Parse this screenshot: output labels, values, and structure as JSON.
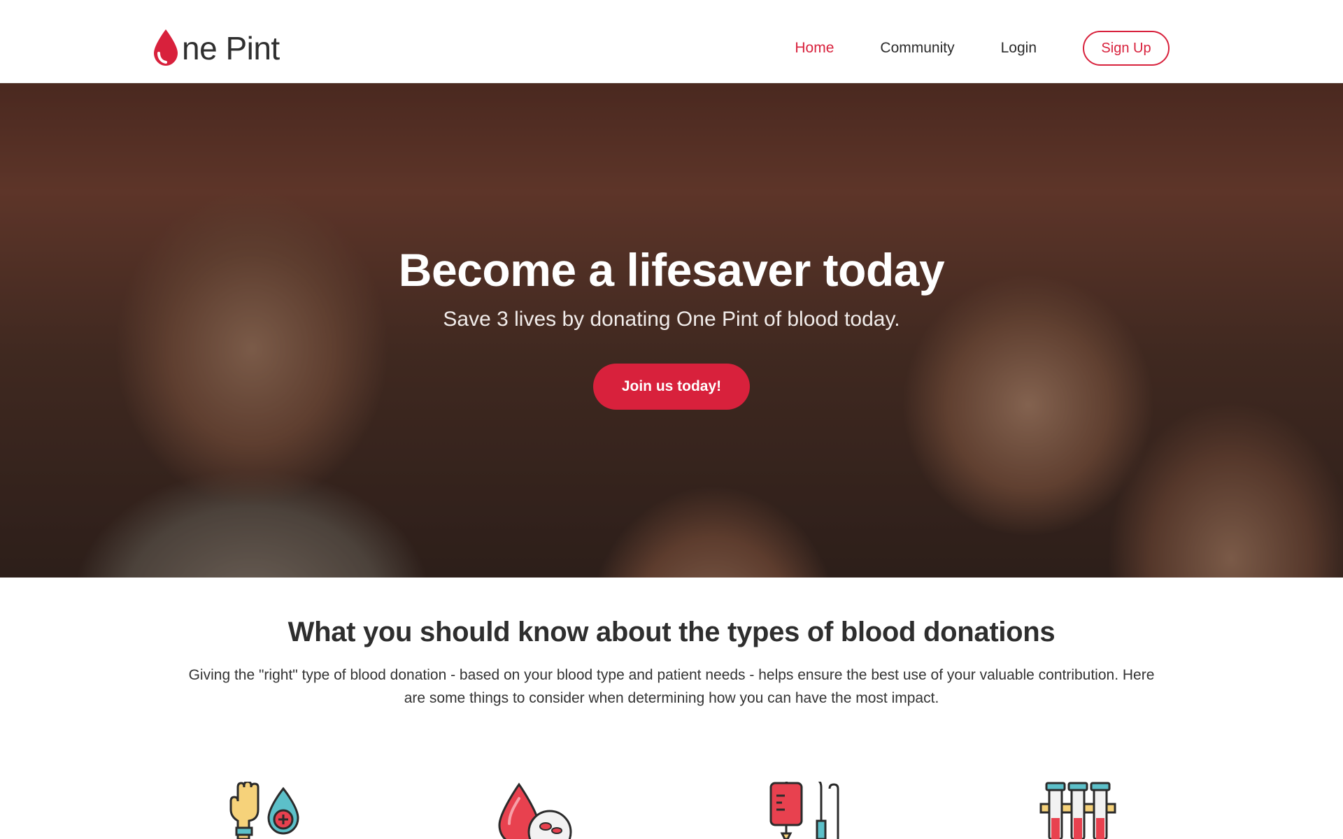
{
  "header": {
    "logo_text": "ne Pint",
    "nav": {
      "home": "Home",
      "community": "Community",
      "login": "Login",
      "signup": "Sign Up"
    }
  },
  "hero": {
    "title": "Become a lifesaver today",
    "subtitle": "Save 3 lives by donating One Pint of blood today.",
    "cta": "Join us today!"
  },
  "info": {
    "title": "What you should know about the types of blood donations",
    "text": "Giving the \"right\" type of blood donation - based on your blood type and patient needs - helps ensure the best use of your valuable contribution. Here are some things to consider when determining how you can have the most impact."
  },
  "icons": [
    "hand-blood-drop-icon",
    "blood-drop-cells-icon",
    "iv-bag-icon",
    "test-tubes-icon"
  ],
  "colors": {
    "brand_red": "#d8213c",
    "text_dark": "#2b2b2b"
  }
}
